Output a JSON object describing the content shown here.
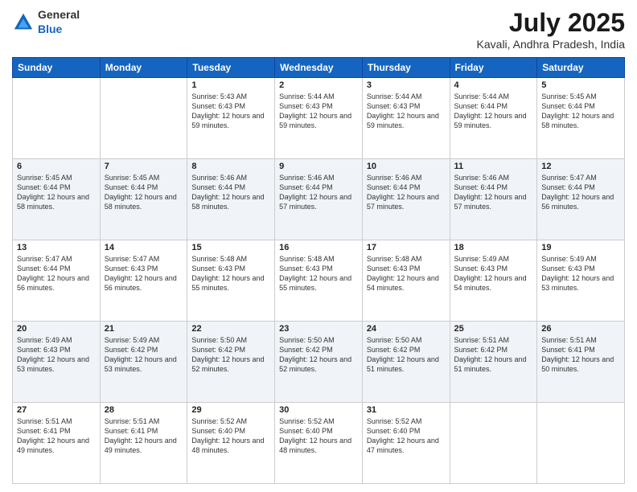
{
  "logo": {
    "general": "General",
    "blue": "Blue"
  },
  "title": "July 2025",
  "subtitle": "Kavali, Andhra Pradesh, India",
  "headers": [
    "Sunday",
    "Monday",
    "Tuesday",
    "Wednesday",
    "Thursday",
    "Friday",
    "Saturday"
  ],
  "weeks": [
    [
      {
        "day": "",
        "sunrise": "",
        "sunset": "",
        "daylight": ""
      },
      {
        "day": "",
        "sunrise": "",
        "sunset": "",
        "daylight": ""
      },
      {
        "day": "1",
        "sunrise": "Sunrise: 5:43 AM",
        "sunset": "Sunset: 6:43 PM",
        "daylight": "Daylight: 12 hours and 59 minutes."
      },
      {
        "day": "2",
        "sunrise": "Sunrise: 5:44 AM",
        "sunset": "Sunset: 6:43 PM",
        "daylight": "Daylight: 12 hours and 59 minutes."
      },
      {
        "day": "3",
        "sunrise": "Sunrise: 5:44 AM",
        "sunset": "Sunset: 6:43 PM",
        "daylight": "Daylight: 12 hours and 59 minutes."
      },
      {
        "day": "4",
        "sunrise": "Sunrise: 5:44 AM",
        "sunset": "Sunset: 6:44 PM",
        "daylight": "Daylight: 12 hours and 59 minutes."
      },
      {
        "day": "5",
        "sunrise": "Sunrise: 5:45 AM",
        "sunset": "Sunset: 6:44 PM",
        "daylight": "Daylight: 12 hours and 58 minutes."
      }
    ],
    [
      {
        "day": "6",
        "sunrise": "Sunrise: 5:45 AM",
        "sunset": "Sunset: 6:44 PM",
        "daylight": "Daylight: 12 hours and 58 minutes."
      },
      {
        "day": "7",
        "sunrise": "Sunrise: 5:45 AM",
        "sunset": "Sunset: 6:44 PM",
        "daylight": "Daylight: 12 hours and 58 minutes."
      },
      {
        "day": "8",
        "sunrise": "Sunrise: 5:46 AM",
        "sunset": "Sunset: 6:44 PM",
        "daylight": "Daylight: 12 hours and 58 minutes."
      },
      {
        "day": "9",
        "sunrise": "Sunrise: 5:46 AM",
        "sunset": "Sunset: 6:44 PM",
        "daylight": "Daylight: 12 hours and 57 minutes."
      },
      {
        "day": "10",
        "sunrise": "Sunrise: 5:46 AM",
        "sunset": "Sunset: 6:44 PM",
        "daylight": "Daylight: 12 hours and 57 minutes."
      },
      {
        "day": "11",
        "sunrise": "Sunrise: 5:46 AM",
        "sunset": "Sunset: 6:44 PM",
        "daylight": "Daylight: 12 hours and 57 minutes."
      },
      {
        "day": "12",
        "sunrise": "Sunrise: 5:47 AM",
        "sunset": "Sunset: 6:44 PM",
        "daylight": "Daylight: 12 hours and 56 minutes."
      }
    ],
    [
      {
        "day": "13",
        "sunrise": "Sunrise: 5:47 AM",
        "sunset": "Sunset: 6:44 PM",
        "daylight": "Daylight: 12 hours and 56 minutes."
      },
      {
        "day": "14",
        "sunrise": "Sunrise: 5:47 AM",
        "sunset": "Sunset: 6:43 PM",
        "daylight": "Daylight: 12 hours and 56 minutes."
      },
      {
        "day": "15",
        "sunrise": "Sunrise: 5:48 AM",
        "sunset": "Sunset: 6:43 PM",
        "daylight": "Daylight: 12 hours and 55 minutes."
      },
      {
        "day": "16",
        "sunrise": "Sunrise: 5:48 AM",
        "sunset": "Sunset: 6:43 PM",
        "daylight": "Daylight: 12 hours and 55 minutes."
      },
      {
        "day": "17",
        "sunrise": "Sunrise: 5:48 AM",
        "sunset": "Sunset: 6:43 PM",
        "daylight": "Daylight: 12 hours and 54 minutes."
      },
      {
        "day": "18",
        "sunrise": "Sunrise: 5:49 AM",
        "sunset": "Sunset: 6:43 PM",
        "daylight": "Daylight: 12 hours and 54 minutes."
      },
      {
        "day": "19",
        "sunrise": "Sunrise: 5:49 AM",
        "sunset": "Sunset: 6:43 PM",
        "daylight": "Daylight: 12 hours and 53 minutes."
      }
    ],
    [
      {
        "day": "20",
        "sunrise": "Sunrise: 5:49 AM",
        "sunset": "Sunset: 6:43 PM",
        "daylight": "Daylight: 12 hours and 53 minutes."
      },
      {
        "day": "21",
        "sunrise": "Sunrise: 5:49 AM",
        "sunset": "Sunset: 6:42 PM",
        "daylight": "Daylight: 12 hours and 53 minutes."
      },
      {
        "day": "22",
        "sunrise": "Sunrise: 5:50 AM",
        "sunset": "Sunset: 6:42 PM",
        "daylight": "Daylight: 12 hours and 52 minutes."
      },
      {
        "day": "23",
        "sunrise": "Sunrise: 5:50 AM",
        "sunset": "Sunset: 6:42 PM",
        "daylight": "Daylight: 12 hours and 52 minutes."
      },
      {
        "day": "24",
        "sunrise": "Sunrise: 5:50 AM",
        "sunset": "Sunset: 6:42 PM",
        "daylight": "Daylight: 12 hours and 51 minutes."
      },
      {
        "day": "25",
        "sunrise": "Sunrise: 5:51 AM",
        "sunset": "Sunset: 6:42 PM",
        "daylight": "Daylight: 12 hours and 51 minutes."
      },
      {
        "day": "26",
        "sunrise": "Sunrise: 5:51 AM",
        "sunset": "Sunset: 6:41 PM",
        "daylight": "Daylight: 12 hours and 50 minutes."
      }
    ],
    [
      {
        "day": "27",
        "sunrise": "Sunrise: 5:51 AM",
        "sunset": "Sunset: 6:41 PM",
        "daylight": "Daylight: 12 hours and 49 minutes."
      },
      {
        "day": "28",
        "sunrise": "Sunrise: 5:51 AM",
        "sunset": "Sunset: 6:41 PM",
        "daylight": "Daylight: 12 hours and 49 minutes."
      },
      {
        "day": "29",
        "sunrise": "Sunrise: 5:52 AM",
        "sunset": "Sunset: 6:40 PM",
        "daylight": "Daylight: 12 hours and 48 minutes."
      },
      {
        "day": "30",
        "sunrise": "Sunrise: 5:52 AM",
        "sunset": "Sunset: 6:40 PM",
        "daylight": "Daylight: 12 hours and 48 minutes."
      },
      {
        "day": "31",
        "sunrise": "Sunrise: 5:52 AM",
        "sunset": "Sunset: 6:40 PM",
        "daylight": "Daylight: 12 hours and 47 minutes."
      },
      {
        "day": "",
        "sunrise": "",
        "sunset": "",
        "daylight": ""
      },
      {
        "day": "",
        "sunrise": "",
        "sunset": "",
        "daylight": ""
      }
    ]
  ]
}
